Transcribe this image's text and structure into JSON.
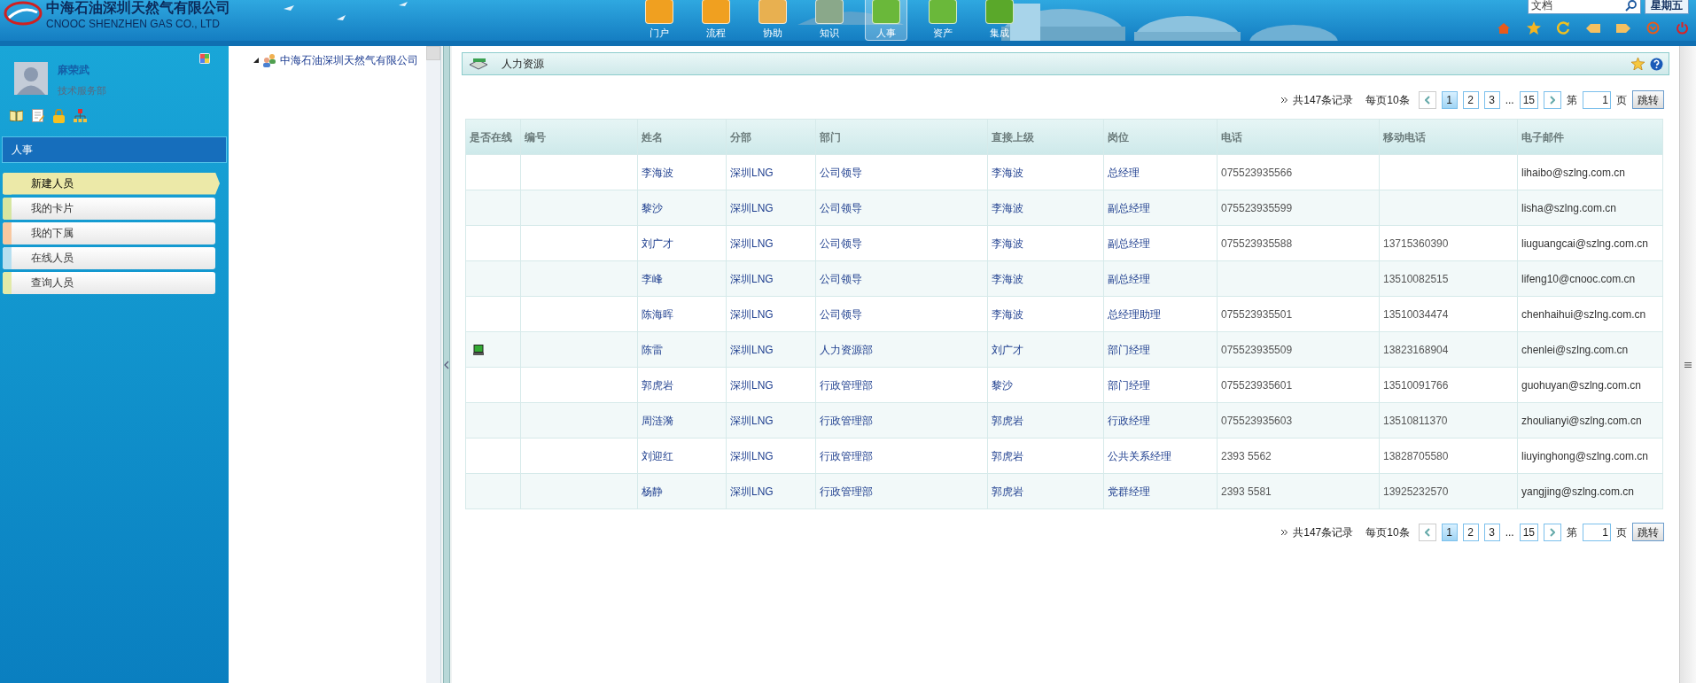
{
  "header": {
    "company_name": "中海石油深圳天然气有限公司",
    "company_name_en": "CNOOC SHENZHEN GAS CO., LTD",
    "nav": [
      {
        "label": "门户",
        "selected": false,
        "color": "#f0a020"
      },
      {
        "label": "流程",
        "selected": false,
        "color": "#f0a020"
      },
      {
        "label": "协助",
        "selected": false,
        "color": "#e8b050"
      },
      {
        "label": "知识",
        "selected": false,
        "color": "#8aa88a"
      },
      {
        "label": "人事",
        "selected": true,
        "color": "#6ab83a"
      },
      {
        "label": "资产",
        "selected": false,
        "color": "#6ab83a"
      },
      {
        "label": "集成",
        "selected": false,
        "color": "#5aa82a"
      }
    ],
    "search": {
      "value": "文档"
    },
    "weekday": "星期五"
  },
  "user": {
    "name": "麻荣武",
    "department": "技术服务部"
  },
  "sidebar": {
    "section": "人事",
    "items": [
      {
        "label": "新建人员",
        "selected": true,
        "color": "#ece9a8"
      },
      {
        "label": "我的卡片",
        "selected": false,
        "color": "#d6e6a0"
      },
      {
        "label": "我的下属",
        "selected": false,
        "color": "#f8c8a0"
      },
      {
        "label": "在线人员",
        "selected": false,
        "color": "#b6dff0"
      },
      {
        "label": "查询人员",
        "selected": false,
        "color": "#e2eaa8"
      }
    ]
  },
  "tree": {
    "root": "中海石油深圳天然气有限公司",
    "expanded": true
  },
  "panel": {
    "title": "人力资源"
  },
  "pagers": [
    {
      "total": "共147条记录",
      "per_page": "每页10条",
      "pages": [
        {
          "label": "1",
          "selected": true
        },
        {
          "label": "2",
          "selected": false
        },
        {
          "label": "3",
          "selected": false
        },
        {
          "label": "15",
          "selected": false
        }
      ],
      "ellipsis": "...",
      "page_prefix": "第",
      "page_value": "1",
      "page_suffix": "页",
      "go": "跳转"
    },
    {
      "total": "共147条记录",
      "per_page": "每页10条",
      "pages": [
        {
          "label": "1",
          "selected": true
        },
        {
          "label": "2",
          "selected": false
        },
        {
          "label": "3",
          "selected": false
        },
        {
          "label": "15",
          "selected": false
        }
      ],
      "ellipsis": "...",
      "page_prefix": "第",
      "page_value": "1",
      "page_suffix": "页",
      "go": "跳转"
    }
  ],
  "table": {
    "columns": [
      "是否在线",
      "编号",
      "姓名",
      "分部",
      "部门",
      "直接上级",
      "岗位",
      "电话",
      "移动电话",
      "电子邮件"
    ],
    "rows": [
      {
        "online": false,
        "name": "李海波",
        "branch": "深圳LNG",
        "department": "公司领导",
        "supervisor": "李海波",
        "position": "总经理",
        "phone": "075523935566",
        "email": "lihaibo@szlng.com.cn"
      },
      {
        "online": false,
        "name": "黎沙",
        "branch": "深圳LNG",
        "department": "公司领导",
        "supervisor": "李海波",
        "position": "副总经理",
        "phone": "075523935599",
        "email": "lisha@szlng.com.cn"
      },
      {
        "online": false,
        "name": "刘广才",
        "branch": "深圳LNG",
        "department": "公司领导",
        "supervisor": "李海波",
        "position": "副总经理",
        "phone": "075523935588",
        "mobile": "13715360390",
        "email": "liuguangcai@szlng.com.cn"
      },
      {
        "online": false,
        "name": "李峰",
        "branch": "深圳LNG",
        "department": "公司领导",
        "supervisor": "李海波",
        "position": "副总经理",
        "mobile": "13510082515",
        "email": "lifeng10@cnooc.com.cn"
      },
      {
        "online": false,
        "name": "陈海晖",
        "branch": "深圳LNG",
        "department": "公司领导",
        "supervisor": "李海波",
        "position": "总经理助理",
        "phone": "075523935501",
        "mobile": "13510034474",
        "email": "chenhaihui@szlng.com.cn"
      },
      {
        "online": true,
        "name": "陈雷",
        "branch": "深圳LNG",
        "department": "人力资源部",
        "supervisor": "刘广才",
        "position": "部门经理",
        "phone": "075523935509",
        "mobile": "13823168904",
        "email": "chenlei@szlng.com.cn"
      },
      {
        "online": false,
        "name": "郭虎岩",
        "branch": "深圳LNG",
        "department": "行政管理部",
        "supervisor": "黎沙",
        "position": "部门经理",
        "phone": "075523935601",
        "mobile": "13510091766",
        "email": "guohuyan@szlng.com.cn"
      },
      {
        "online": false,
        "name": "周涟漪",
        "branch": "深圳LNG",
        "department": "行政管理部",
        "supervisor": "郭虎岩",
        "position": "行政经理",
        "phone": "075523935603",
        "mobile": "13510811370",
        "email": "zhoulianyi@szlng.com.cn"
      },
      {
        "online": false,
        "name": "刘迎红",
        "branch": "深圳LNG",
        "department": "行政管理部",
        "supervisor": "郭虎岩",
        "position": "公共关系经理",
        "phone": "2393 5562",
        "mobile": "13828705580",
        "email": "liuyinghong@szlng.com.cn"
      },
      {
        "online": false,
        "name": "杨静",
        "branch": "深圳LNG",
        "department": "行政管理部",
        "supervisor": "郭虎岩",
        "position": "党群经理",
        "phone": "2393 5581",
        "mobile": "13925232570",
        "email": "yangjing@szlng.com.cn"
      }
    ]
  }
}
